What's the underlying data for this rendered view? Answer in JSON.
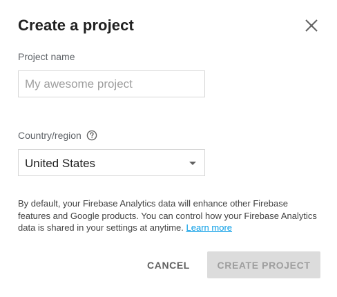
{
  "dialog": {
    "title": "Create a project",
    "close_icon": "close-icon"
  },
  "project_name": {
    "label": "Project name",
    "value": "",
    "placeholder": "My awesome project"
  },
  "country": {
    "label": "Country/region",
    "help_icon": "help-circle-icon",
    "selected": "United States",
    "caret_icon": "dropdown-caret-icon"
  },
  "info": {
    "text": "By default, your Firebase Analytics data will enhance other Firebase features and Google products. You can control how your Firebase Analytics data is shared in your settings at anytime.",
    "link_text": "Learn more"
  },
  "actions": {
    "cancel_label": "CANCEL",
    "create_label": "CREATE PROJECT",
    "create_enabled": false
  },
  "colors": {
    "link": "#039be5",
    "disabled_button_bg": "#dcdcdc",
    "disabled_button_text": "#9e9e9e"
  }
}
